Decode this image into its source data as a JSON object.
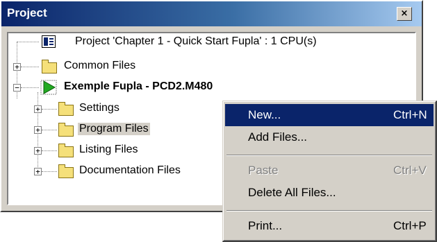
{
  "window": {
    "title": "Project",
    "close_glyph": "×"
  },
  "tree": {
    "project_root": "Project 'Chapter 1 - Quick Start Fupla' : 1 CPU(s)",
    "common_files": "Common Files",
    "cpu_node": "Exemple Fupla - PCD2.M480",
    "children": [
      {
        "label": "Settings"
      },
      {
        "label": "Program Files"
      },
      {
        "label": "Listing Files"
      },
      {
        "label": "Documentation Files"
      }
    ]
  },
  "context_menu": {
    "items": [
      {
        "label": "New...",
        "shortcut": "Ctrl+N",
        "state": "highlighted"
      },
      {
        "label": "Add Files...",
        "shortcut": "",
        "state": "enabled"
      },
      {
        "label": "Paste",
        "shortcut": "Ctrl+V",
        "state": "disabled"
      },
      {
        "label": "Delete All Files...",
        "shortcut": "",
        "state": "enabled"
      },
      {
        "label": "Print...",
        "shortcut": "Ctrl+P",
        "state": "enabled"
      }
    ]
  },
  "icons": {
    "project": "project-file-icon",
    "folder": "folder-icon",
    "cpu": "cpu-play-icon",
    "expand": "expand-plus-icon",
    "collapse": "collapse-minus-icon"
  },
  "colors": {
    "title_bar_start": "#0a246a",
    "title_bar_end": "#a6caf0",
    "menu_highlight": "#0a246a",
    "window_face": "#d4d0c8",
    "cpu_icon": "#22aa22"
  }
}
